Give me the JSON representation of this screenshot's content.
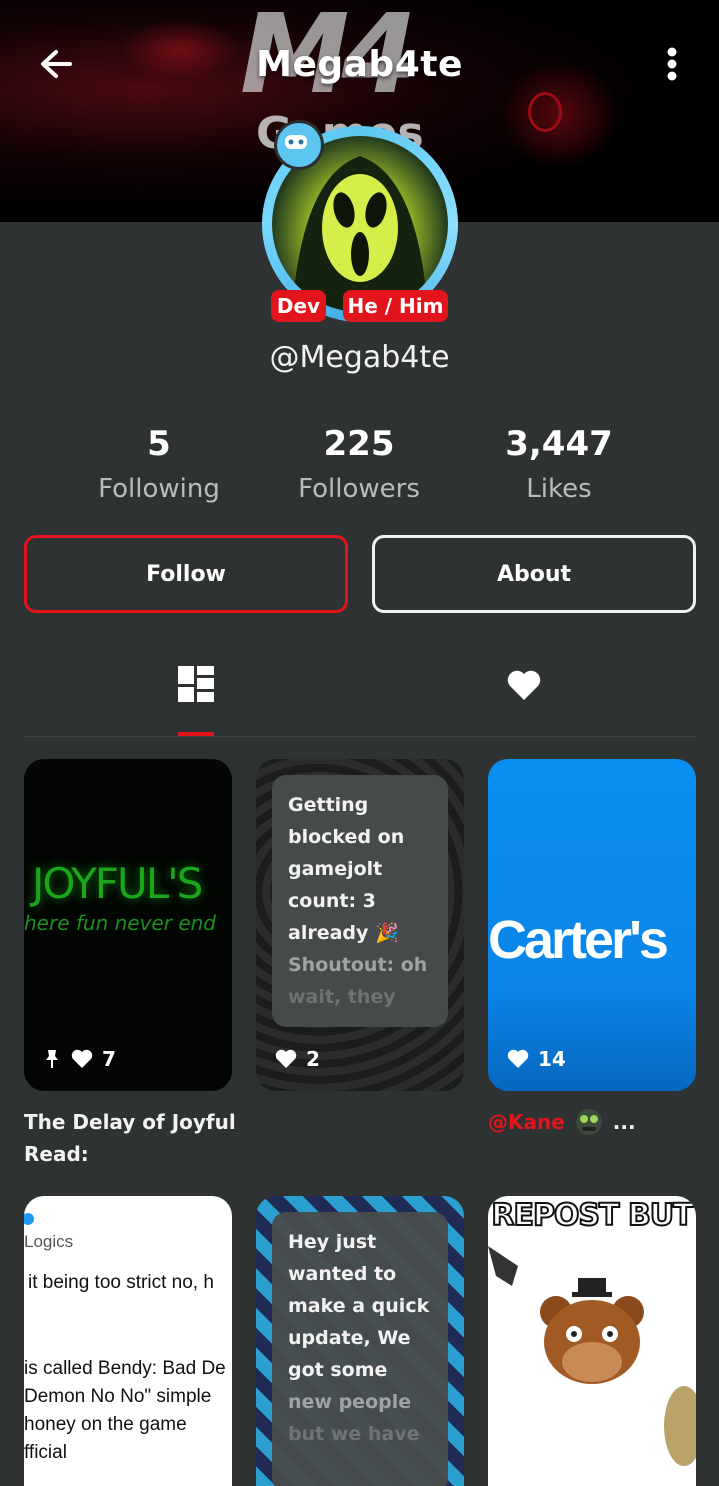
{
  "header": {
    "title": "Megab4te",
    "banner_text_1": "M4",
    "banner_text_2": "Games"
  },
  "profile": {
    "tags": [
      "Dev",
      "He / Him"
    ],
    "handle": "@Megab4te",
    "stats": [
      {
        "value": "5",
        "label": "Following"
      },
      {
        "value": "225",
        "label": "Followers"
      },
      {
        "value": "3,447",
        "label": "Likes"
      }
    ],
    "follow_label": "Follow",
    "about_label": "About"
  },
  "tabs": [
    {
      "name": "posts",
      "icon": "posts-grid-icon",
      "selected": true
    },
    {
      "name": "liked",
      "icon": "heart-icon",
      "selected": false
    }
  ],
  "posts": [
    {
      "image_text_1": "JOYFUL'S",
      "image_text_2": "here fun never end",
      "pinned": true,
      "likes": "7",
      "caption": "The Delay of Joyful Read:"
    },
    {
      "text_lines": [
        "Getting",
        "blocked on",
        "gamejolt",
        "count: 3",
        "already 🎉",
        "Shoutout: oh",
        "wait, they"
      ],
      "likes": "2"
    },
    {
      "image_text": "Carter's",
      "likes": "14",
      "caption_user": "@Kane",
      "caption_more": "..."
    },
    {
      "screenshot_lines": [
        "Logics",
        "it being too strict no, h",
        "is called Bendy: Bad De",
        "Demon No No\" simple",
        "honey on the game",
        "fficial"
      ]
    },
    {
      "text_lines": [
        "Hey just",
        "wanted to",
        "make a quick",
        "update, We",
        "got some",
        "new people",
        "but we have"
      ]
    },
    {
      "image_text": "REPOST BUT"
    }
  ],
  "colors": {
    "accent": "#e3151c",
    "background": "#2f3233",
    "ring": "#5cc6f0",
    "carters_blue": "#0a84e8"
  }
}
